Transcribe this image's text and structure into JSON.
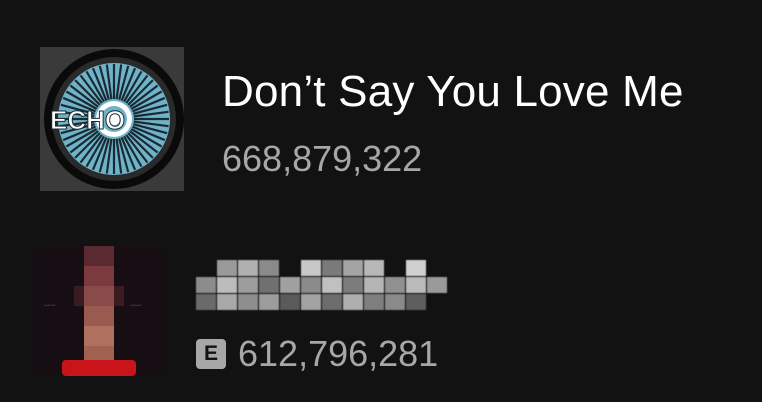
{
  "tracks": [
    {
      "title": "Don’t Say You Love Me",
      "plays": "668,879,322",
      "explicit": false,
      "cover_text": "ECHO",
      "cover_colors": {
        "frame": "#3a3a3a",
        "ring_outer": "#0a0a0a",
        "disc": "#6fb3c9",
        "rays": "#1a2a33",
        "center": "#ffffff"
      }
    },
    {
      "title_redacted": true,
      "plays": "612,796,281",
      "explicit": true,
      "explicit_label": "E",
      "cover_colors": {
        "background": "#160e12",
        "figure": "#b04e4e",
        "base": "#c8141a"
      }
    }
  ],
  "colors": {
    "background": "#121212",
    "title_text": "#ffffff",
    "secondary_text": "#a7a7a7"
  }
}
